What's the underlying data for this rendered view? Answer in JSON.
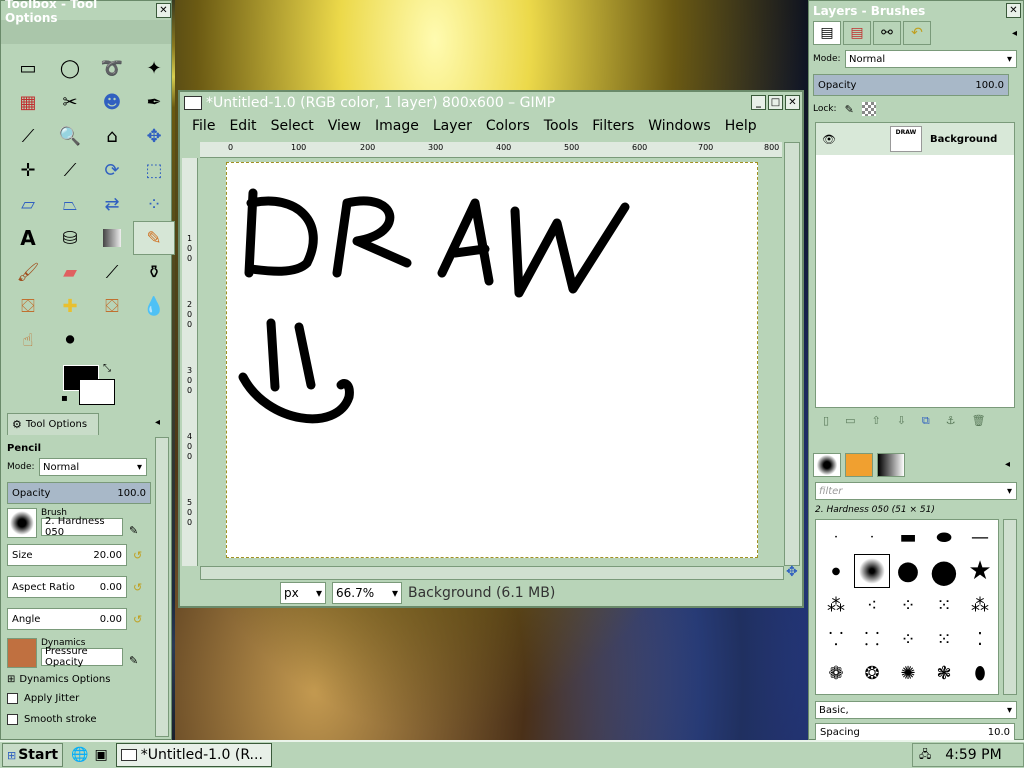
{
  "toolbox": {
    "title": "Toolbox - Tool Options",
    "tool_options_tab": "Tool Options",
    "tool_name": "Pencil",
    "mode_label": "Mode:",
    "mode_value": "Normal",
    "opacity_label": "Opacity",
    "opacity_value": "100.0",
    "brush_label": "Brush",
    "brush_value": "2. Hardness 050",
    "size_label": "Size",
    "size_value": "20.00",
    "aspect_label": "Aspect Ratio",
    "aspect_value": "0.00",
    "angle_label": "Angle",
    "angle_value": "0.00",
    "dynamics_label": "Dynamics",
    "dynamics_value": "Pressure Opacity",
    "dynamics_options": "Dynamics Options",
    "apply_jitter": "Apply Jitter",
    "smooth_stroke": "Smooth stroke",
    "fg_color": "#000000",
    "bg_color": "#ffffff"
  },
  "image_window": {
    "title": "*Untitled-1.0 (RGB color, 1 layer) 800x600 – GIMP",
    "menu": [
      "File",
      "Edit",
      "Select",
      "View",
      "Image",
      "Layer",
      "Colors",
      "Tools",
      "Filters",
      "Windows",
      "Help"
    ],
    "ruler_h": [
      "0",
      "100",
      "200",
      "300",
      "400",
      "500",
      "600",
      "700",
      "800"
    ],
    "ruler_v": [
      "1",
      "0",
      "0",
      "2",
      "0",
      "0",
      "3",
      "0",
      "0",
      "4",
      "0",
      "0",
      "5",
      "0",
      "0"
    ],
    "unit": "px",
    "zoom": "66.7%",
    "status": "Background (6.1 MB)",
    "canvas_text": "DRAW"
  },
  "layers": {
    "title": "Layers - Brushes",
    "mode_label": "Mode:",
    "mode_value": "Normal",
    "opacity_label": "Opacity",
    "opacity_value": "100.0",
    "lock_label": "Lock:",
    "layer_name": "Background",
    "thumb_text": "DRAW"
  },
  "brushes": {
    "filter_placeholder": "filter",
    "selected_brush": "2. Hardness 050 (51 × 51)",
    "set": "Basic,",
    "spacing_label": "Spacing",
    "spacing_value": "10.0"
  },
  "taskbar": {
    "start": "Start",
    "task": "*Untitled-1.0 (R...",
    "clock": "4:59 PM"
  }
}
